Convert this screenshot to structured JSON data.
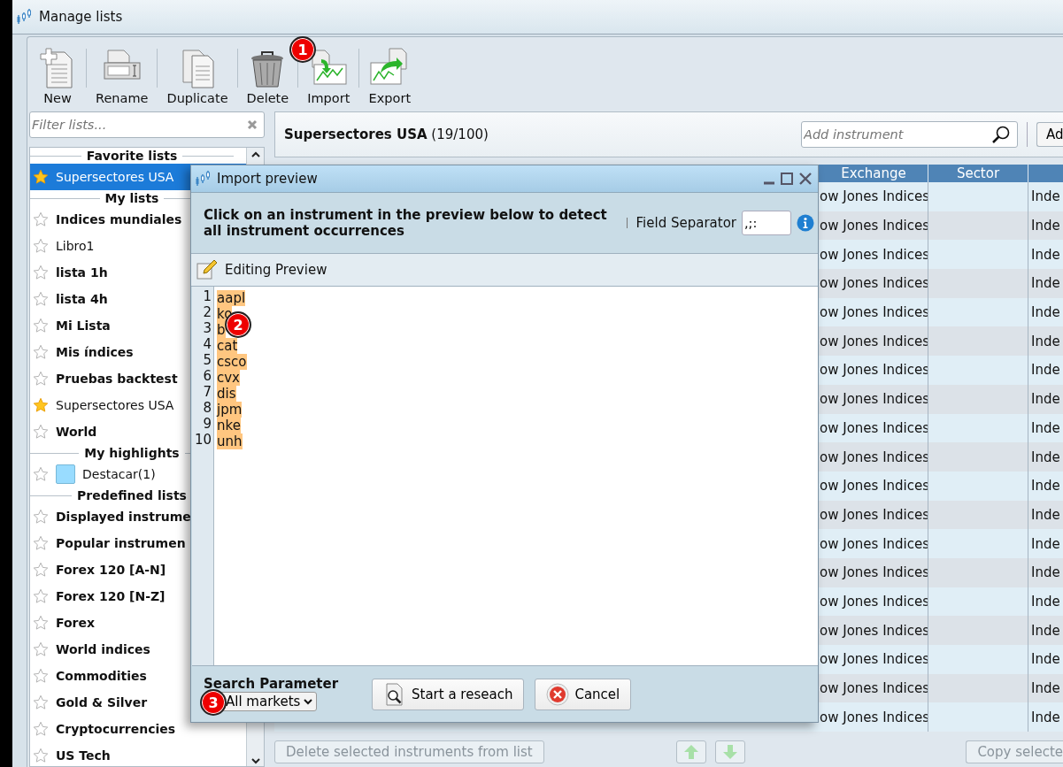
{
  "window": {
    "title": "Manage lists"
  },
  "toolbar": [
    {
      "label": "New",
      "kind": "new"
    },
    {
      "label": "Rename",
      "kind": "rename"
    },
    {
      "label": "Duplicate",
      "kind": "duplicate"
    },
    {
      "label": "Delete",
      "kind": "delete"
    },
    {
      "label": "Import",
      "kind": "import"
    },
    {
      "label": "Export",
      "kind": "export"
    }
  ],
  "filter": {
    "placeholder": "Filter lists..."
  },
  "lists": [
    {
      "title": "Favorite lists",
      "items": [
        {
          "label": "Supersectores USA",
          "kind": "list",
          "bold": false,
          "favorite": true,
          "selected": true
        }
      ]
    },
    {
      "title": "My lists",
      "items": [
        {
          "label": "Indices mundiales",
          "kind": "list",
          "bold": true,
          "favorite": false,
          "selected": false
        },
        {
          "label": "Libro1",
          "kind": "list",
          "bold": false,
          "favorite": false,
          "selected": false
        },
        {
          "label": "lista 1h",
          "kind": "list",
          "bold": true,
          "favorite": false,
          "selected": false
        },
        {
          "label": "lista 4h",
          "kind": "list",
          "bold": true,
          "favorite": false,
          "selected": false
        },
        {
          "label": "Mi Lista",
          "kind": "list",
          "bold": true,
          "favorite": false,
          "selected": false
        },
        {
          "label": "Mis índices",
          "kind": "list",
          "bold": true,
          "favorite": false,
          "selected": false
        },
        {
          "label": "Pruebas backtest",
          "kind": "list",
          "bold": true,
          "favorite": false,
          "selected": false
        },
        {
          "label": "Supersectores USA",
          "kind": "list",
          "bold": false,
          "favorite": true,
          "selected": false
        },
        {
          "label": "World",
          "kind": "list",
          "bold": true,
          "favorite": false,
          "selected": false
        }
      ]
    },
    {
      "title": "My highlights",
      "items": [
        {
          "label": "Destacar(1)",
          "kind": "highlight",
          "color": "#99dcff",
          "bold": false,
          "favorite": false,
          "selected": false
        }
      ]
    },
    {
      "title": "Predefined lists",
      "items": [
        {
          "label": "Displayed instrume",
          "kind": "list",
          "bold": true,
          "favorite": false,
          "selected": false
        },
        {
          "label": "Popular instrumen",
          "kind": "list",
          "bold": true,
          "favorite": false,
          "selected": false
        },
        {
          "label": "Forex 120 [A-N]",
          "kind": "list",
          "bold": true,
          "favorite": false,
          "selected": false
        },
        {
          "label": "Forex 120 [N-Z]",
          "kind": "list",
          "bold": true,
          "favorite": false,
          "selected": false
        },
        {
          "label": "Forex",
          "kind": "list",
          "bold": true,
          "favorite": false,
          "selected": false
        },
        {
          "label": "World indices",
          "kind": "list",
          "bold": true,
          "favorite": false,
          "selected": false
        },
        {
          "label": "Commodities",
          "kind": "list",
          "bold": true,
          "favorite": false,
          "selected": false
        },
        {
          "label": "Gold & Silver",
          "kind": "list",
          "bold": true,
          "favorite": false,
          "selected": false
        },
        {
          "label": "Cryptocurrencies",
          "kind": "list",
          "bold": true,
          "favorite": false,
          "selected": false
        },
        {
          "label": "US Tech",
          "kind": "list",
          "bold": true,
          "favorite": false,
          "selected": false
        }
      ]
    }
  ],
  "list_header": {
    "title": "Supersectores USA",
    "count": "(19/100)"
  },
  "add_instrument": {
    "placeholder": "Add instrument"
  },
  "add_button": "Ad",
  "table": {
    "columns": [
      {
        "label": "Exchange"
      },
      {
        "label": "Sector"
      }
    ],
    "rows": [
      {
        "exchange": "ow Jones Indices",
        "column_3": "Inde"
      },
      {
        "exchange": "ow Jones Indices",
        "column_3": "Inde"
      },
      {
        "exchange": "ow Jones Indices",
        "column_3": "Inde"
      },
      {
        "exchange": "ow Jones Indices",
        "column_3": "Inde"
      },
      {
        "exchange": "ow Jones Indices",
        "column_3": "Inde"
      },
      {
        "exchange": "ow Jones Indices",
        "column_3": "Inde"
      },
      {
        "exchange": "ow Jones Indices",
        "column_3": "Inde"
      },
      {
        "exchange": "ow Jones Indices",
        "column_3": "Inde"
      },
      {
        "exchange": "ow Jones Indices",
        "column_3": "Inde"
      },
      {
        "exchange": "ow Jones Indices",
        "column_3": "Inde"
      },
      {
        "exchange": "ow Jones Indices",
        "column_3": "Inde"
      },
      {
        "exchange": "ow Jones Indices",
        "column_3": "Inde"
      },
      {
        "exchange": "ow Jones Indices",
        "column_3": "Inde"
      },
      {
        "exchange": "ow Jones Indices",
        "column_3": "Inde"
      },
      {
        "exchange": "ow Jones Indices",
        "column_3": "Inde"
      },
      {
        "exchange": "ow Jones Indices",
        "column_3": "Inde"
      },
      {
        "exchange": "ow Jones Indices",
        "column_3": "Inde"
      },
      {
        "exchange": "ow Jones Indices",
        "column_3": "Inde"
      },
      {
        "exchange": "ow Jones Indices",
        "column_3": "Inde"
      }
    ]
  },
  "delete_button": "Delete selected instruments from list",
  "copy_button": "Copy selecte",
  "dialog": {
    "title": "Import preview",
    "instruction": "Click on an instrument in the preview below to detect all instrument occurrences",
    "field_separator": {
      "label": "Field Separator",
      "value": ",;:"
    },
    "editing_label": "Editing Preview",
    "lines": [
      {
        "number": "1",
        "text": "aapl"
      },
      {
        "number": "2",
        "text": "ko"
      },
      {
        "number": "3",
        "text": "b"
      },
      {
        "number": "4",
        "text": "cat"
      },
      {
        "number": "5",
        "text": "csco"
      },
      {
        "number": "6",
        "text": "cvx"
      },
      {
        "number": "7",
        "text": "dis"
      },
      {
        "number": "8",
        "text": "jpm"
      },
      {
        "number": "9",
        "text": "nke"
      },
      {
        "number": "10",
        "text": "unh"
      }
    ],
    "search": {
      "label": "Search Parameter",
      "value": "All markets"
    },
    "buttons": [
      {
        "label": "Start a reseach",
        "kind": "search"
      },
      {
        "label": "Cancel",
        "kind": "cancel"
      }
    ]
  },
  "callouts": [
    "1",
    "2",
    "3"
  ]
}
